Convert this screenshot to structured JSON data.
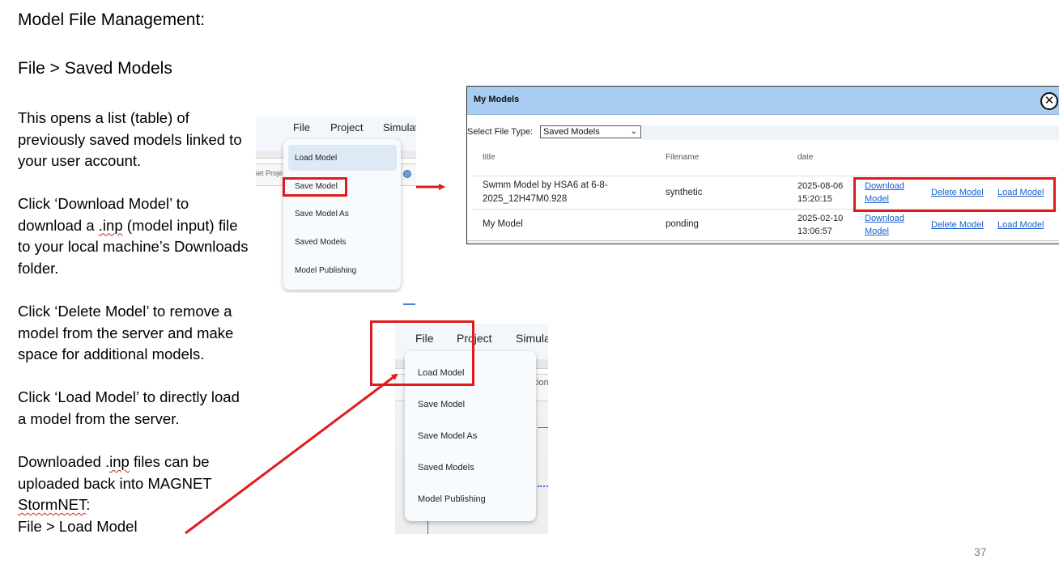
{
  "slide": {
    "title": "Model File Management:",
    "subtitle": "File > Saved Models",
    "para1": [
      "This opens a list (table) of",
      "previously saved models linked to",
      "your user account."
    ],
    "para2": [
      "Click ‘Download Model’ to",
      "download a ",
      ".inp",
      " (model input) file",
      "to your local machine’s Downloads",
      "folder."
    ],
    "para3": [
      "Click ‘Delete Model’ to remove a",
      "model from the server and make",
      "space for additional models."
    ],
    "para4": [
      "Click ‘Load Model’ to directly load",
      "a model from the server."
    ],
    "para5": [
      "Downloaded .",
      "inp",
      " files can be",
      "uploaded back into MAGNET",
      "StormNET",
      ":",
      "File > Load Model"
    ],
    "page_number": "37"
  },
  "menu_shot_1": {
    "menubar": [
      "File",
      "Project",
      "Simulat"
    ],
    "background_text": "Set Proje",
    "items": [
      "Load Model",
      "Save Model",
      "Save Model As",
      "Saved Models",
      "Model Publishing"
    ],
    "highlighted_item": "Save Model"
  },
  "menu_shot_2": {
    "menubar": [
      "File",
      "Project",
      "Simula"
    ],
    "background_text": "tion",
    "items": [
      "Load Model",
      "Save Model",
      "Save Model As",
      "Saved Models",
      "Model Publishing"
    ],
    "highlighted_item": "Load Model"
  },
  "dialog": {
    "title": "My Models",
    "close_icon": "close-circle-icon",
    "filter_label": "Select File Type:",
    "filter_value": "Saved Models",
    "columns": [
      "title",
      "Filename",
      "date"
    ],
    "rows": [
      {
        "title": [
          "Swmm Model by HSA6 at 6-8-",
          "2025_12H47M0.928"
        ],
        "filename": "synthetic",
        "date": [
          "2025-08-06",
          "15:20:15"
        ],
        "download": [
          "Download",
          "Model"
        ],
        "delete": "Delete Model",
        "load": "Load Model"
      },
      {
        "title": [
          "My Model"
        ],
        "filename": "ponding",
        "date": [
          "2025-02-10",
          "13:06:57"
        ],
        "download": [
          "Download",
          "Model"
        ],
        "delete": "Delete Model",
        "load": "Load Model"
      }
    ]
  },
  "colors": {
    "annotation_red": "#e01b1b",
    "dialog_header": "#a9cdf0",
    "link_blue": "#1a5fd0"
  }
}
